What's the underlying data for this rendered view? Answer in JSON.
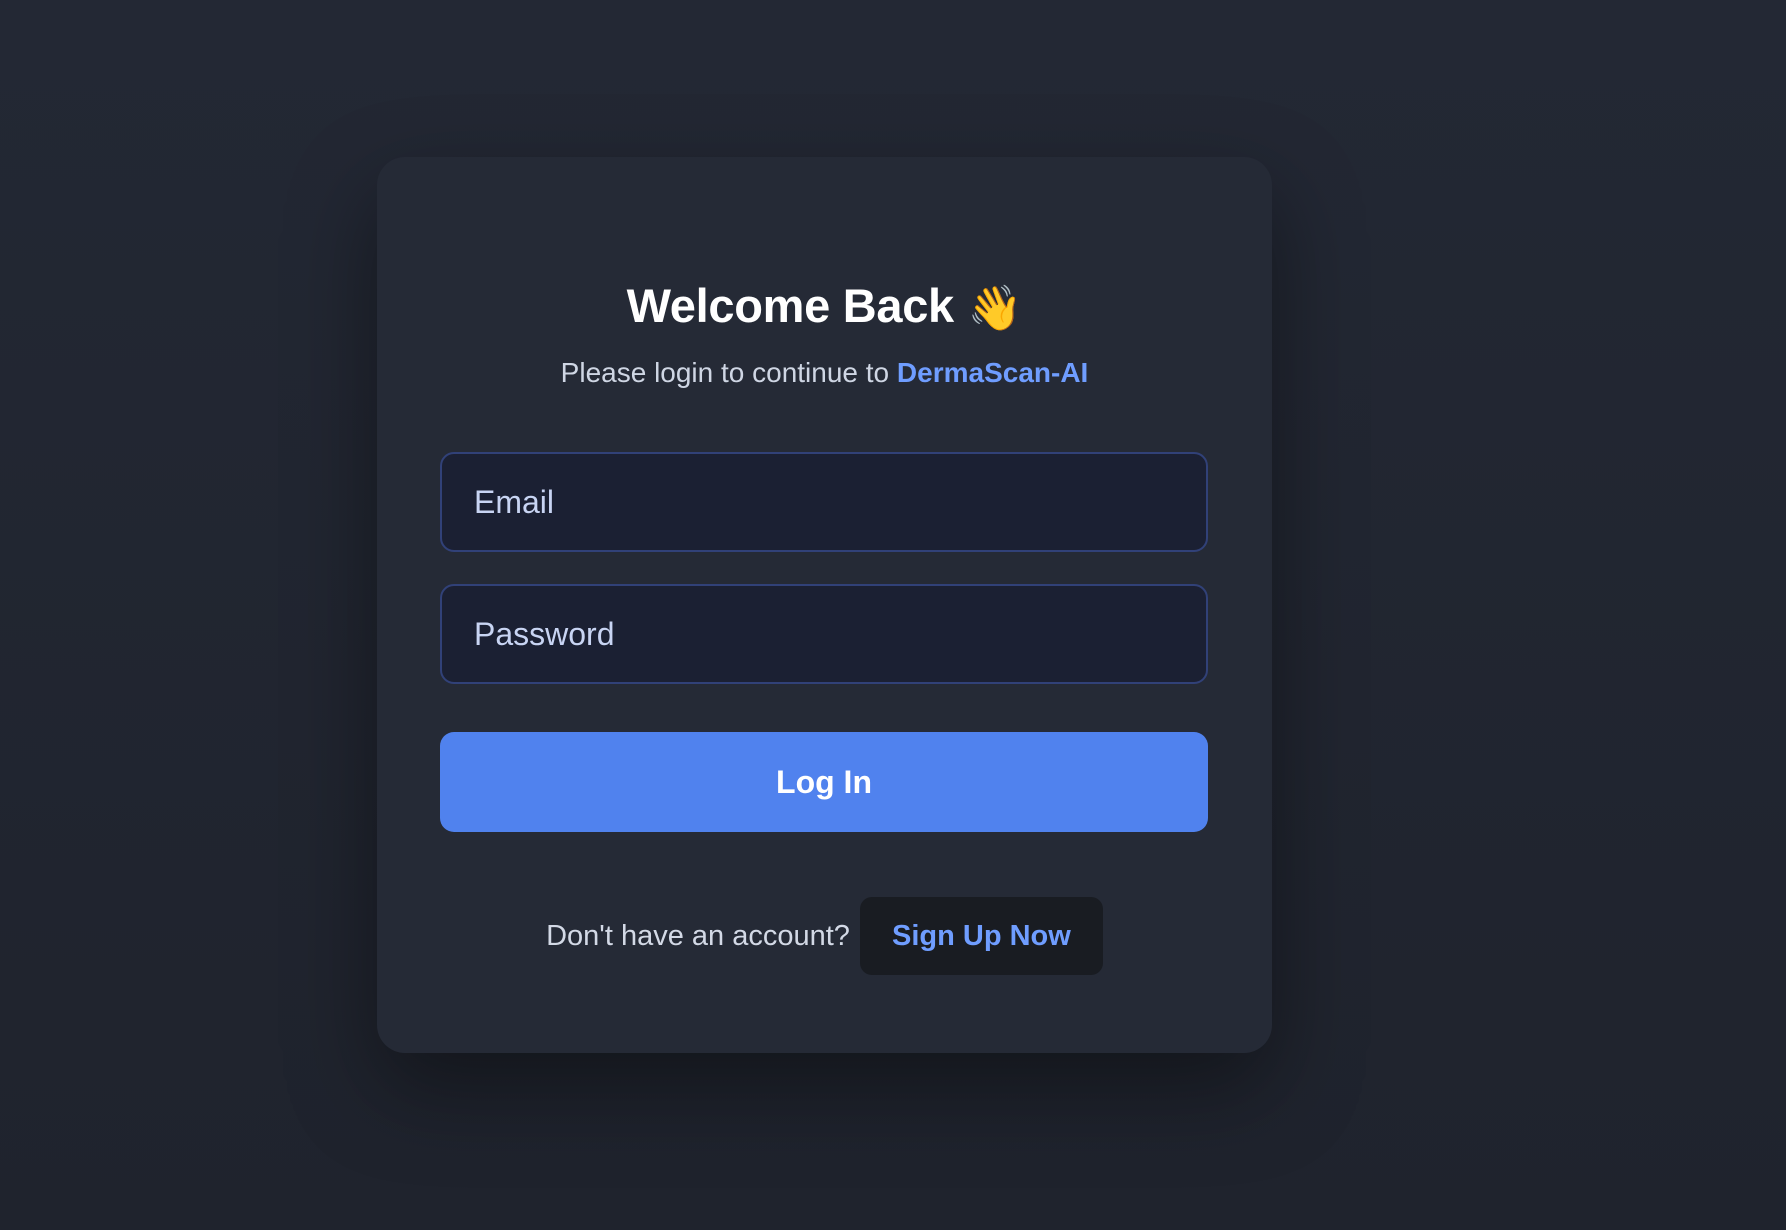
{
  "login_card": {
    "title": "Welcome Back",
    "title_icon": "waving-hand-icon",
    "subtitle_prefix": "Please login to continue to ",
    "brand_name": "DermaScan-AI",
    "email_placeholder": "Email",
    "password_placeholder": "Password",
    "login_button_label": "Log In",
    "signup_prompt": "Don't have an account?",
    "signup_button_label": "Sign Up Now"
  },
  "colors": {
    "background": "#222733",
    "card": "#252a36",
    "accent": "#5082ee",
    "brand_text": "#6f9dff",
    "input_background": "#1b2033",
    "input_border": "#314178",
    "signup_button_background": "#191c22"
  }
}
